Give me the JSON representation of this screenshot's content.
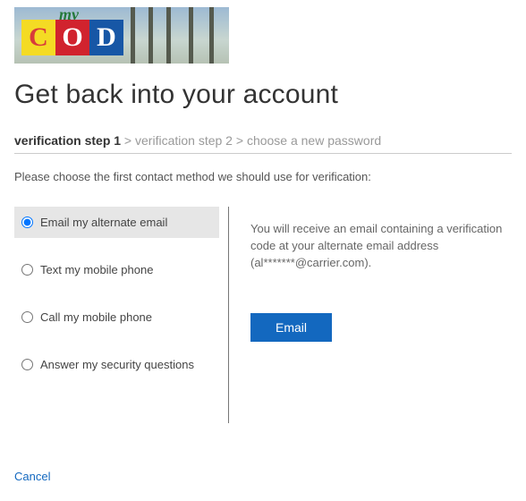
{
  "logo": {
    "my": "my",
    "c": "C",
    "o": "O",
    "d": "D"
  },
  "page_title": "Get back into your account",
  "steps": {
    "step1": "verification step 1",
    "sep": " > ",
    "step2": "verification step 2",
    "step3": "choose a new password"
  },
  "instruction": "Please choose the first contact method we should use for verification:",
  "options": {
    "email_alt": "Email my alternate email",
    "text_mobile": "Text my mobile phone",
    "call_mobile": "Call my mobile phone",
    "security_q": "Answer my security questions"
  },
  "detail": {
    "message": "You will receive an email containing a verification code at your alternate email address (al*******@carrier.com).",
    "button": "Email"
  },
  "cancel": "Cancel"
}
